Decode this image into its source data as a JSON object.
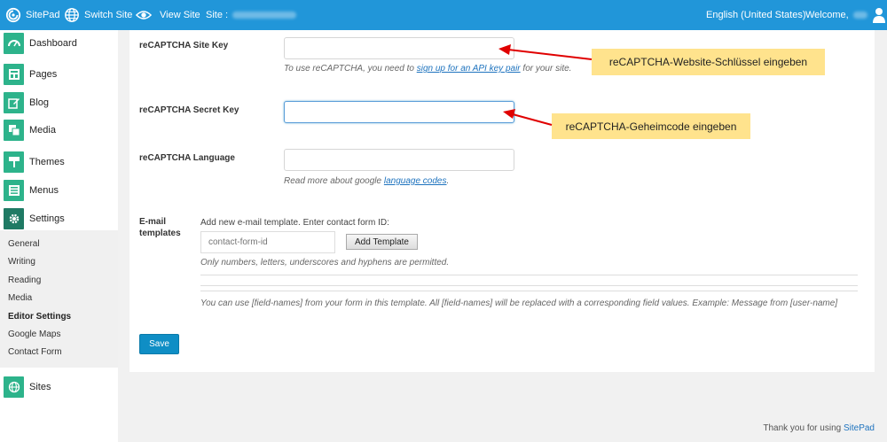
{
  "topbar": {
    "brand": "SitePad",
    "switch_site": "Switch Site",
    "view_site": "View Site",
    "site_label": "Site :",
    "language": "English (United States)",
    "welcome": "Welcome,"
  },
  "sidebar": {
    "items": [
      {
        "label": "Dashboard",
        "icon": "dashboard-icon"
      },
      {
        "label": "Pages",
        "icon": "pages-icon"
      },
      {
        "label": "Blog",
        "icon": "blog-icon"
      },
      {
        "label": "Media",
        "icon": "media-icon"
      },
      {
        "label": "Themes",
        "icon": "themes-icon"
      },
      {
        "label": "Menus",
        "icon": "menus-icon"
      },
      {
        "label": "Settings",
        "icon": "settings-icon"
      },
      {
        "label": "Sites",
        "icon": "sites-icon"
      }
    ],
    "subitems": [
      "General",
      "Writing",
      "Reading",
      "Media",
      "Editor Settings",
      "Google Maps",
      "Contact Form"
    ],
    "active_subitem": "Editor Settings",
    "accent_color": "#2db38b"
  },
  "form": {
    "site_key": {
      "label": "reCAPTCHA Site Key",
      "value": "",
      "help_before": "To use reCAPTCHA, you need to",
      "help_link": "sign up for an API key pair",
      "help_after": "for your site."
    },
    "secret_key": {
      "label": "reCAPTCHA Secret Key",
      "value": ""
    },
    "language": {
      "label": "reCAPTCHA Language",
      "value": "",
      "help_before": "Read more about google",
      "help_link": "language codes",
      "help_after": "."
    },
    "email_templates": {
      "label_line1": "E-mail",
      "label_line2": "templates",
      "intro": "Add new e-mail template. Enter contact form ID:",
      "placeholder": "contact-form-id",
      "add_button": "Add Template",
      "note": "Only numbers, letters, underscores and hyphens are permitted.",
      "info": "You can use [field-names] from your form in this template. All [field-names] will be replaced with a corresponding field values. Example: Message from [user-name]"
    },
    "save_button": "Save"
  },
  "annotations": {
    "site_key_callout": "reCAPTCHA-Website-Schlüssel eingeben",
    "secret_key_callout": "reCAPTCHA-Geheimcode eingeben",
    "arrow_color": "#e00000",
    "callout_color": "#ffe38d"
  },
  "footer": {
    "text": "Thank you for using",
    "link": "SitePad"
  }
}
